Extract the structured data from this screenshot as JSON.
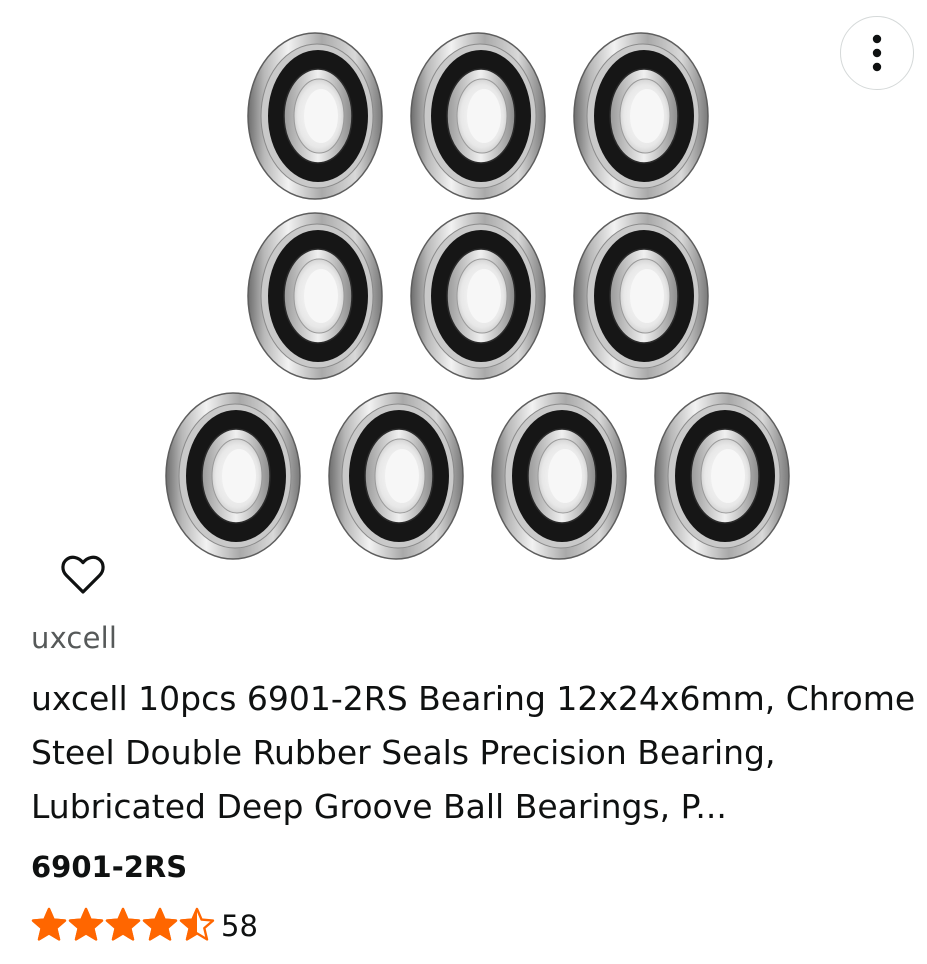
{
  "product": {
    "brand": "uxcell",
    "title": "uxcell 10pcs 6901-2RS Bearing 12x24x6mm, Chrome Steel Double Rubber Seals Precision Bearing, Lubricated Deep Groove Ball Bearings, P...",
    "variant": "6901-2RS",
    "rating": 4.5,
    "rating_max": 5,
    "review_count": "58",
    "image_alt": "10 pcs 6901-2RS deep groove ball bearings"
  },
  "icons": {
    "more": "more-vertical-icon",
    "wishlist": "heart-outline-icon",
    "star": "star-icon"
  },
  "colors": {
    "star": "#ff6600",
    "brand_text": "#565959",
    "title_text": "#0f1111",
    "button_border": "#d5d9d9"
  }
}
